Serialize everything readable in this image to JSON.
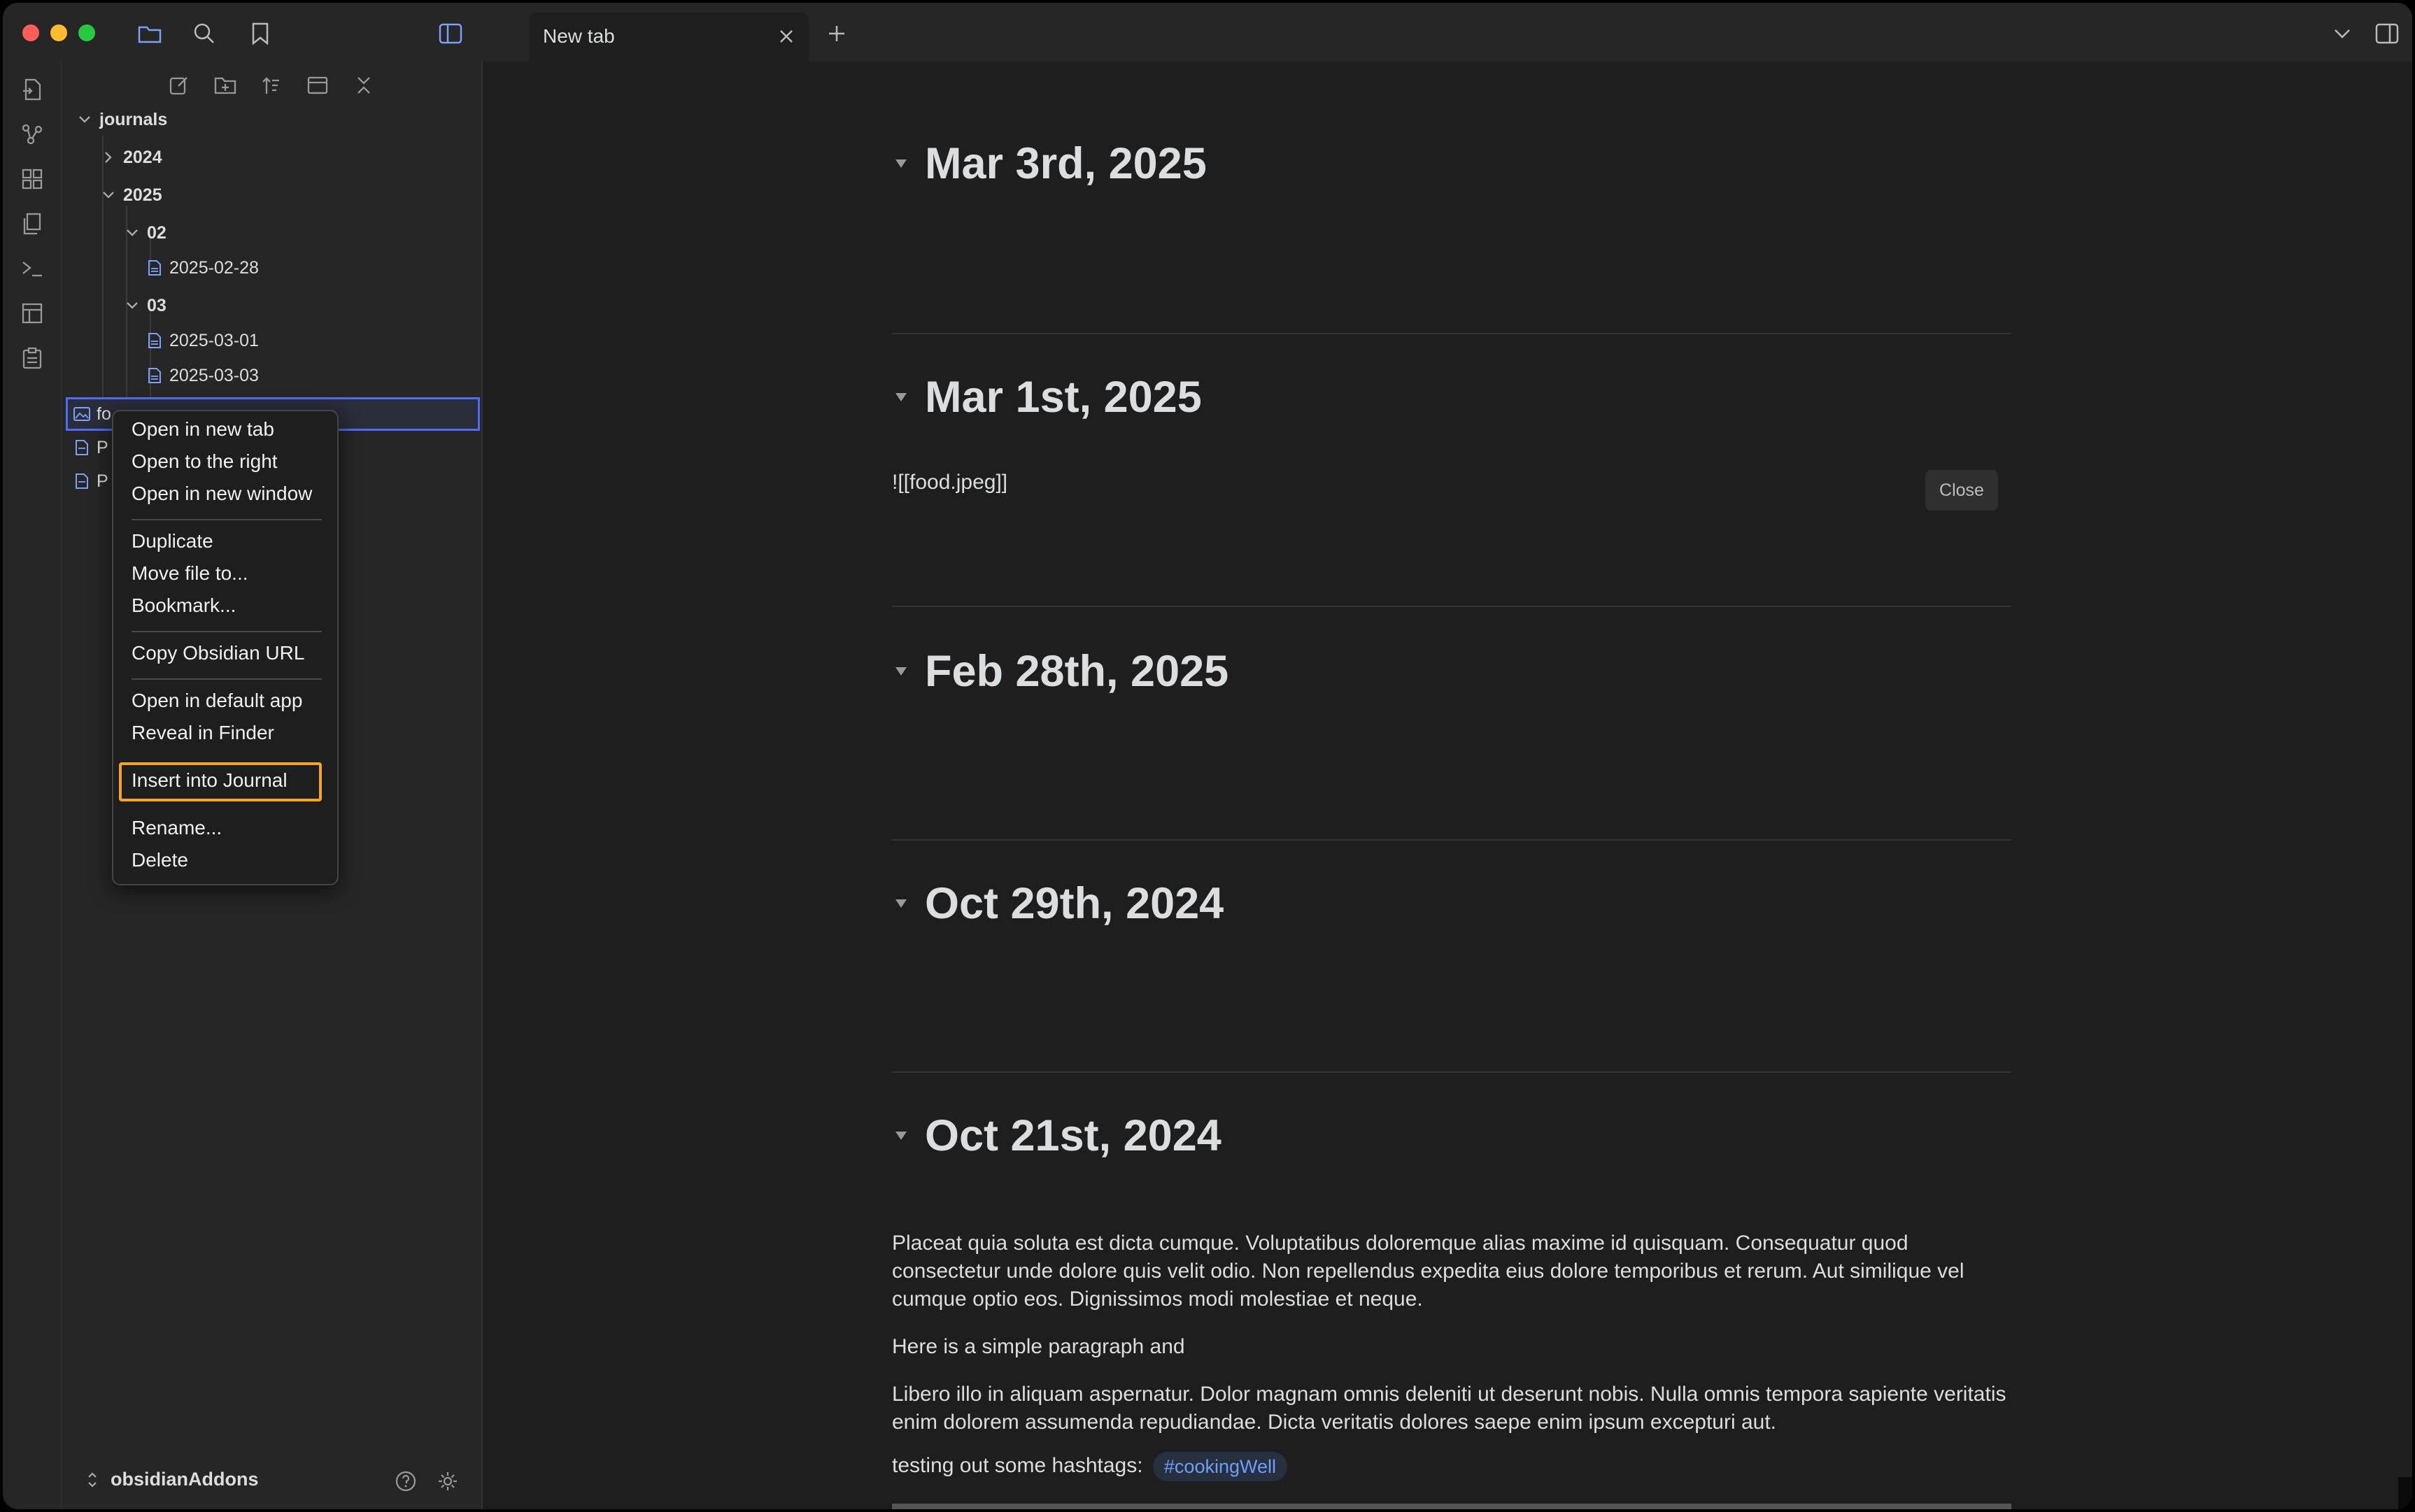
{
  "window": {
    "tab_title": "New tab",
    "colors": {
      "close": "#ff5f57",
      "minimize": "#febc2e",
      "zoom": "#28c840"
    }
  },
  "titlebar_icons": [
    "folder-icon",
    "search-icon",
    "bookmark-icon",
    "sidebar-toggle-icon",
    "new-tab-plus-icon",
    "tab-list-chevron-icon",
    "right-sidebar-toggle-icon"
  ],
  "ribbon_icons": [
    "open-quick-switcher-icon",
    "graph-view-icon",
    "canvas-icon",
    "templates-icon",
    "command-palette-icon",
    "daily-notes-icon",
    "calendar-icon"
  ],
  "file_explorer": {
    "toolbar": [
      "new-note-icon",
      "new-folder-icon",
      "sort-icon",
      "auto-reveal-icon",
      "collapse-all-icon"
    ],
    "tree": {
      "journals": "journals",
      "y2024": "2024",
      "y2025": "2025",
      "m02": "02",
      "f0228": "2025-02-28",
      "m03": "03",
      "f0301": "2025-03-01",
      "f0303": "2025-03-03",
      "food": "fo",
      "p1": "P",
      "p2": "P"
    },
    "vault_name": "obsidianAddons"
  },
  "context_menu": {
    "open_new_tab": "Open in new tab",
    "open_right": "Open to the right",
    "open_new_window": "Open in new window",
    "duplicate": "Duplicate",
    "move": "Move file to...",
    "bookmark": "Bookmark...",
    "copy_url": "Copy Obsidian URL",
    "open_default": "Open in default app",
    "reveal": "Reveal in Finder",
    "insert_journal": "Insert into Journal",
    "rename": "Rename...",
    "delete": "Delete",
    "highlight_color": "#f5a524"
  },
  "main": {
    "entries": [
      {
        "title": "Mar 3rd, 2025"
      },
      {
        "title": "Mar 1st, 2025"
      },
      {
        "title": "Feb 28th, 2025"
      },
      {
        "title": "Oct 29th, 2024"
      },
      {
        "title": "Oct 21st, 2024"
      }
    ],
    "mar1_embed": "![[food.jpeg]]",
    "close_label": "Close",
    "para1": "Placeat quia soluta est dicta cumque. Voluptatibus doloremque alias maxime id quisquam. Consequatur quod consectetur unde dolore quis velit odio. Non repellendus expedita eius dolore temporibus et rerum. Aut similique vel cumque optio eos. Dignissimos modi molestiae et neque.",
    "para2": "Here is a simple paragraph and",
    "para3": "Libero illo in aliquam aspernatur. Dolor magnam omnis deleniti ut deserunt nobis. Nulla omnis tempora sapiente veritatis enim dolorem assumenda repudiandae. Dicta veritatis dolores saepe enim ipsum excepturi aut.",
    "hashtag_prefix": "testing out some hashtags:",
    "hashtag": "#cookingWell"
  }
}
